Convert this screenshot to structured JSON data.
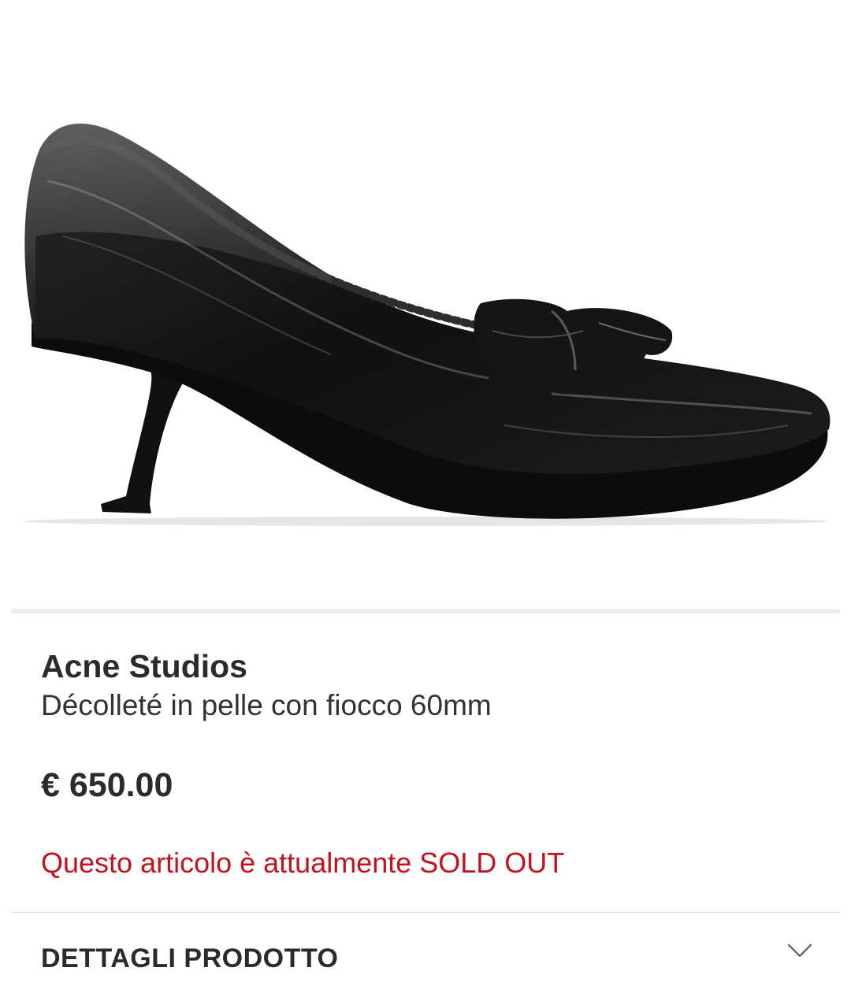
{
  "product": {
    "image_icon": "shoe-image",
    "brand": "Acne Studios",
    "name": "Décolleté in pelle con fiocco 60mm",
    "price": "€ 650.00",
    "availability": "Questo articolo è attualmente SOLD OUT",
    "availability_color": "#c1121f"
  },
  "details": {
    "label": "DETTAGLI PRODOTTO",
    "icon": "chevron-down-icon"
  }
}
